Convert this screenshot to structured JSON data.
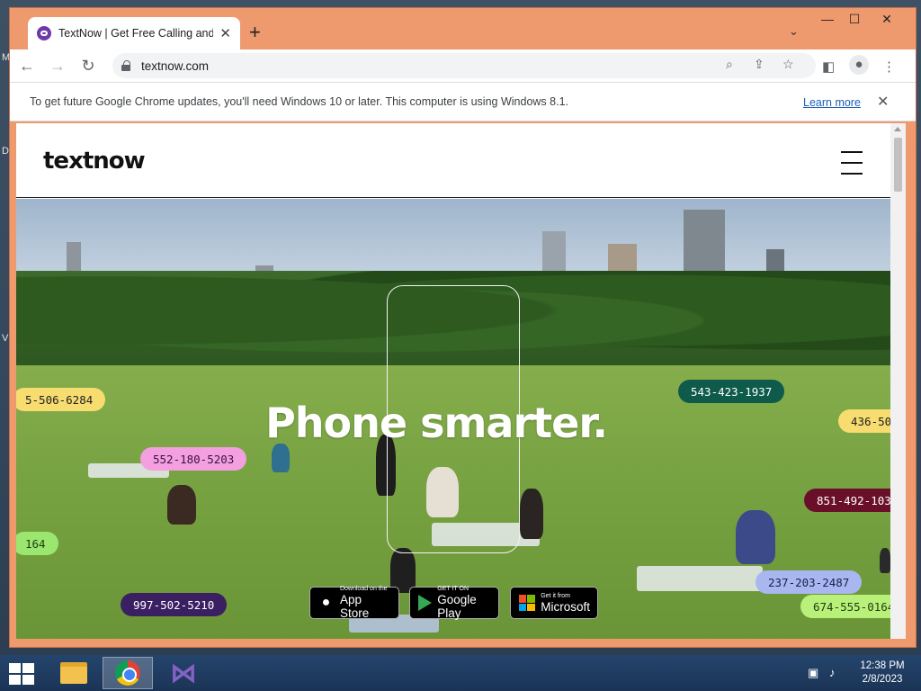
{
  "desktop": {
    "letters": [
      "M",
      "D",
      "V"
    ]
  },
  "browser": {
    "tab_title": "TextNow | Get Free Calling and Te",
    "tab_close": "✕",
    "new_tab": "+",
    "tab_search": "⌄",
    "window_controls": {
      "minimize": "—",
      "maximize": "☐",
      "close": "✕"
    },
    "url": "textnow.com",
    "infobar": {
      "message": "To get future Google Chrome updates, you'll need Windows 10 or later. This computer is using Windows 8.1.",
      "link": "Learn more",
      "close": "✕"
    },
    "icons": [
      "back-icon",
      "forward-icon",
      "reload-icon",
      "lock-icon",
      "zoom-icon",
      "share-icon",
      "bookmark-star-icon",
      "side-panel-icon",
      "profile-icon",
      "menu-icon"
    ]
  },
  "site": {
    "logo": "textnow",
    "headline": "Phone smarter.",
    "pills": [
      {
        "text": "5-506-6284",
        "bg": "#f7dc6f",
        "fg": "#222222"
      },
      {
        "text": "552-180-5203",
        "bg": "#f39fe0",
        "fg": "#3a1144"
      },
      {
        "text": "164",
        "bg": "#9ae66e",
        "fg": "#1e3d10"
      },
      {
        "text": "997-502-5210",
        "bg": "#3b1f63",
        "fg": "#ffffff"
      },
      {
        "text": "543-423-1937",
        "bg": "#0e5a4b",
        "fg": "#ffffff"
      },
      {
        "text": "436-50",
        "bg": "#f7dc6f",
        "fg": "#222222"
      },
      {
        "text": "851-492-103",
        "bg": "#6a0f2a",
        "fg": "#ffffff"
      },
      {
        "text": "237-203-2487",
        "bg": "#a8b7f0",
        "fg": "#1b1f4a"
      },
      {
        "text": "674-555-0164",
        "bg": "#b8f07a",
        "fg": "#1e3d10"
      }
    ],
    "stores": [
      {
        "small": "Download on the",
        "big": "App Store",
        "icon": "apple-icon"
      },
      {
        "small": "GET IT ON",
        "big": "Google Play",
        "icon": "google-play-icon"
      },
      {
        "small": "Get it from",
        "big": "Microsoft",
        "icon": "microsoft-icon"
      }
    ]
  },
  "taskbar": {
    "apps": [
      "file-explorer-icon",
      "chrome-icon",
      "visual-studio-icon"
    ],
    "time": "12:38 PM",
    "date": "2/8/2023"
  },
  "colors": {
    "window_frame": "#ee9a6e",
    "taskbar": "#1e3a5f",
    "link": "#1a5fb4"
  }
}
